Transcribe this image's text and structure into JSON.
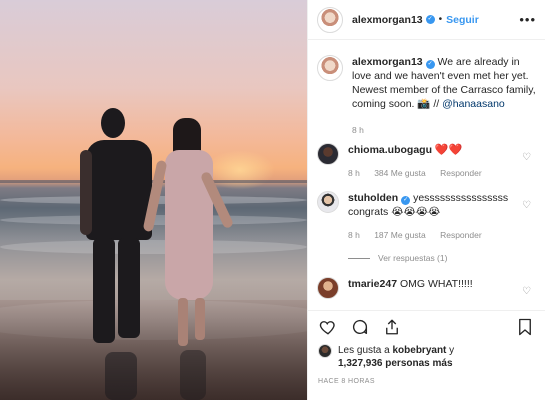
{
  "header": {
    "username": "alexmorgan13",
    "follow_label": "Seguir",
    "dot": "•",
    "more": "•••"
  },
  "caption": {
    "username": "alexmorgan13",
    "text_1": "We are already in love and we haven't even met her yet. Newest member of the Carrasco family, coming soon. 📸 //",
    "mention": "@hanaasano",
    "age": "8 h"
  },
  "comments": [
    {
      "username": "chioma.ubogagu",
      "text": "❤️❤️",
      "age": "8 h",
      "likes": "384 Me gusta",
      "reply": "Responder"
    },
    {
      "username": "stuholden",
      "text": "yessssssssssssssss congrats 😭😭😭😭",
      "age": "8 h",
      "likes": "187 Me gusta",
      "reply": "Responder",
      "view_replies": "Ver respuestas (1)"
    },
    {
      "username": "tmarie247",
      "text": "OMG WHAT!!!!!"
    }
  ],
  "likes": {
    "line_1_prefix": "Les gusta a ",
    "user": "kobebryant",
    "line_1_suffix": " y",
    "count": "1,327,936 personas más"
  },
  "timestamp": "HACE 8 HORAS",
  "icons": [
    "heart-icon",
    "comment-icon",
    "share-icon",
    "save-icon",
    "more-icon",
    "verified-icon"
  ],
  "colors": {
    "link": "#3897f0",
    "mention": "#00376b",
    "muted": "#8e8e8e"
  }
}
